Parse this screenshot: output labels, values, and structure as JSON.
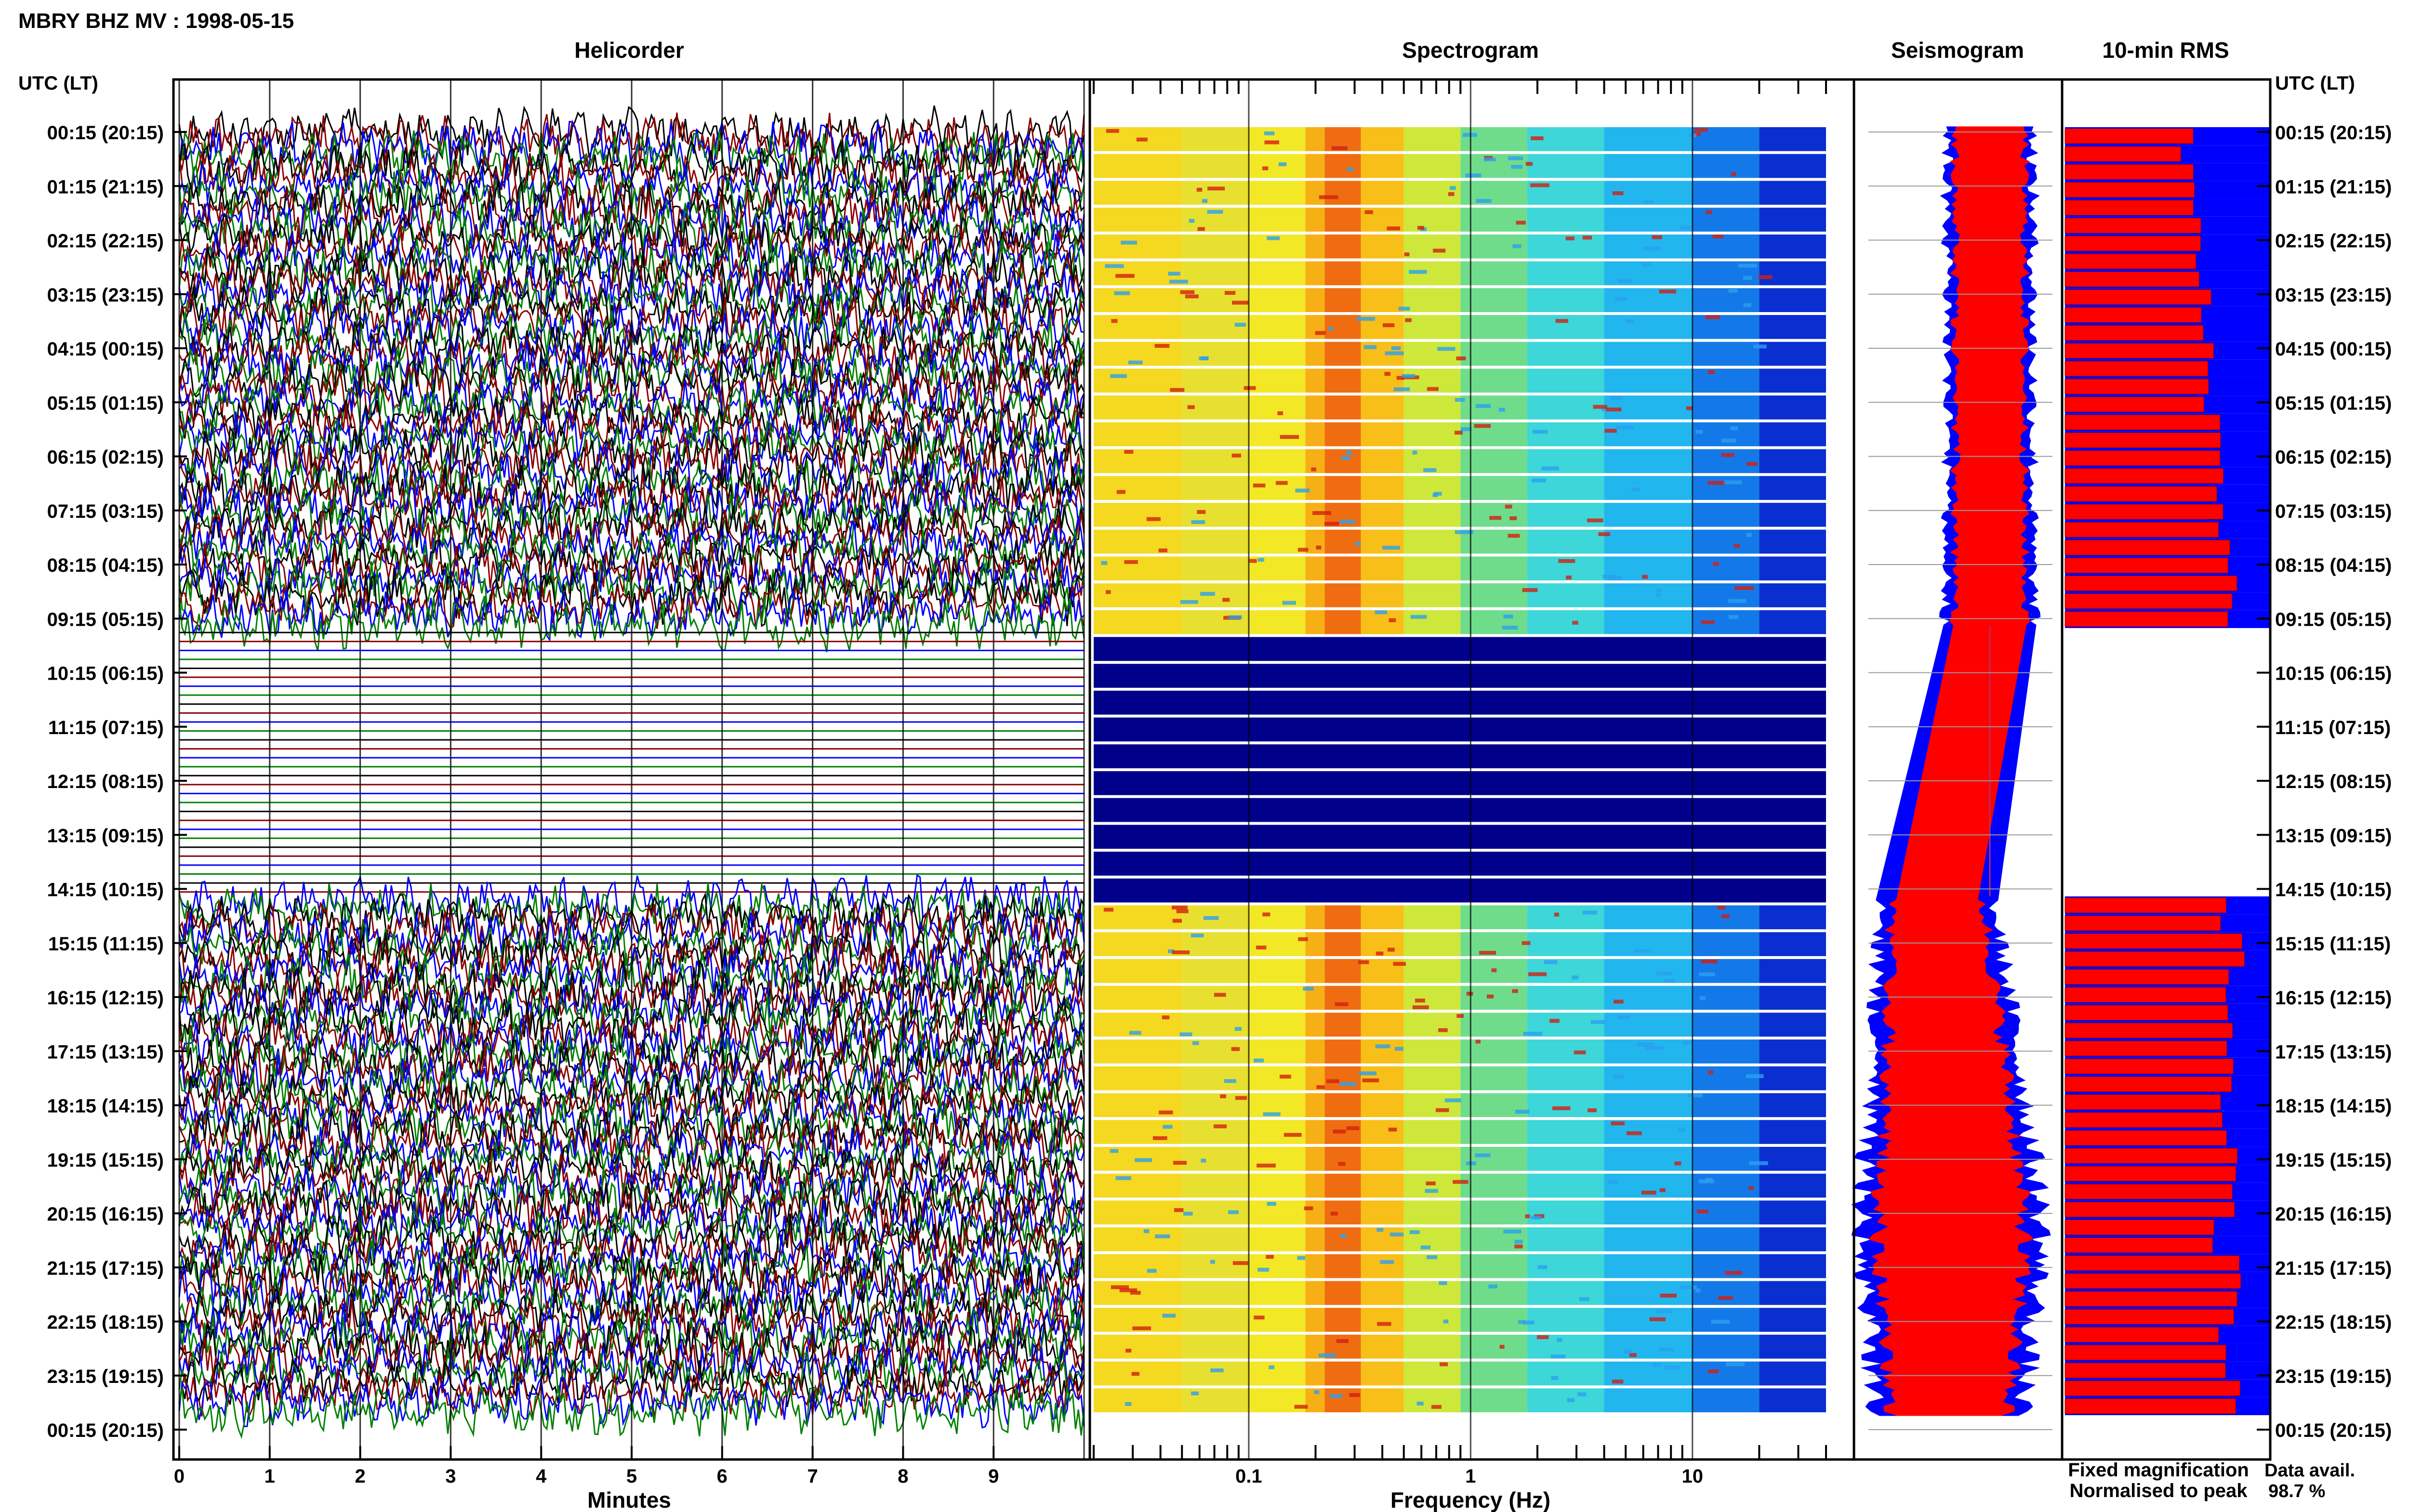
{
  "page_title": "MBRY BHZ MV : 1998-05-15",
  "panels": {
    "helicorder": "Helicorder",
    "spectrogram": "Spectrogram",
    "seismogram": "Seismogram",
    "rms": "10-min RMS"
  },
  "time_axis_label": "UTC (LT)",
  "time_labels": [
    "00:15 (20:15)",
    "01:15 (21:15)",
    "02:15 (22:15)",
    "03:15 (23:15)",
    "04:15 (00:15)",
    "05:15 (01:15)",
    "06:15 (02:15)",
    "07:15 (03:15)",
    "08:15 (04:15)",
    "09:15 (05:15)",
    "10:15 (06:15)",
    "11:15 (07:15)",
    "12:15 (08:15)",
    "13:15 (09:15)",
    "14:15 (10:15)",
    "15:15 (11:15)",
    "16:15 (12:15)",
    "17:15 (13:15)",
    "18:15 (14:15)",
    "19:15 (15:15)",
    "20:15 (16:15)",
    "21:15 (17:15)",
    "22:15 (18:15)",
    "23:15 (19:15)",
    "00:15 (20:15)"
  ],
  "helicorder_xlabel": "Minutes",
  "helicorder_ticks": [
    "0",
    "1",
    "2",
    "3",
    "4",
    "5",
    "6",
    "7",
    "8",
    "9"
  ],
  "spectrogram_xlabel": "Frequency (Hz)",
  "spectrogram_ticks": [
    "0.1",
    "1",
    "10"
  ],
  "legend": {
    "fixed": "Fixed magnification",
    "normalised": "Normalised to peak",
    "fixed_color": "#0000ff",
    "normalised_color": "#ff0000"
  },
  "data_avail": {
    "label": "Data avail.",
    "value": "98.7 %"
  },
  "colors": {
    "trace_colors": [
      "#000000",
      "#8b0000",
      "#0000ff",
      "#008000"
    ],
    "gap_fill": "#00008b",
    "rms_fixed": "#0000ff",
    "rms_normalised": "#ff0000"
  },
  "chart_data": {
    "type": "heatmap",
    "title": "MBRY BHZ MV : 1998-05-15",
    "station": "MBRY",
    "channel": "BHZ",
    "network": "MV",
    "date": "1998-05-15",
    "helicorder": {
      "xlabel": "Minutes",
      "xlim": [
        0,
        10
      ],
      "rows": 144,
      "row_minutes": 10,
      "data_gap_utc": [
        "09:15",
        "14:15"
      ]
    },
    "spectrogram": {
      "xlabel": "Frequency (Hz)",
      "xscale": "log",
      "xlim": [
        0.02,
        40
      ],
      "dominant_band_hz": [
        0.2,
        0.5
      ],
      "colormap": "jet"
    },
    "rms": {
      "interval_minutes": 10,
      "series": [
        {
          "name": "Fixed magnification",
          "color": "#0000ff"
        },
        {
          "name": "Normalised to peak",
          "color": "#ff0000"
        }
      ]
    },
    "data_availability_percent": 98.7
  }
}
